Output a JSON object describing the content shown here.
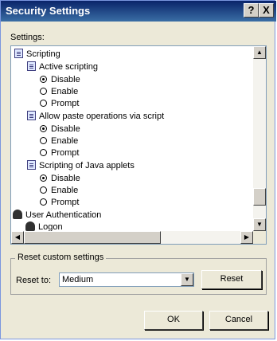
{
  "window": {
    "title": "Security Settings",
    "help_button": "?",
    "close_button": "X"
  },
  "settings_label": "Settings:",
  "tree": {
    "scripting": "Scripting",
    "active_scripting": {
      "label": "Active scripting",
      "options": [
        "Disable",
        "Enable",
        "Prompt"
      ],
      "selected": "Disable"
    },
    "allow_paste": {
      "label": "Allow paste operations via script",
      "options": [
        "Disable",
        "Enable",
        "Prompt"
      ],
      "selected": "Disable"
    },
    "java_applets": {
      "label": "Scripting of Java applets",
      "options": [
        "Disable",
        "Enable",
        "Prompt"
      ],
      "selected": "Disable"
    },
    "user_auth": "User Authentication",
    "logon": "Logon"
  },
  "reset_group": {
    "title": "Reset custom settings",
    "reset_to_label": "Reset to:",
    "reset_to_value": "Medium",
    "reset_button": "Reset"
  },
  "footer": {
    "ok": "OK",
    "cancel": "Cancel"
  }
}
